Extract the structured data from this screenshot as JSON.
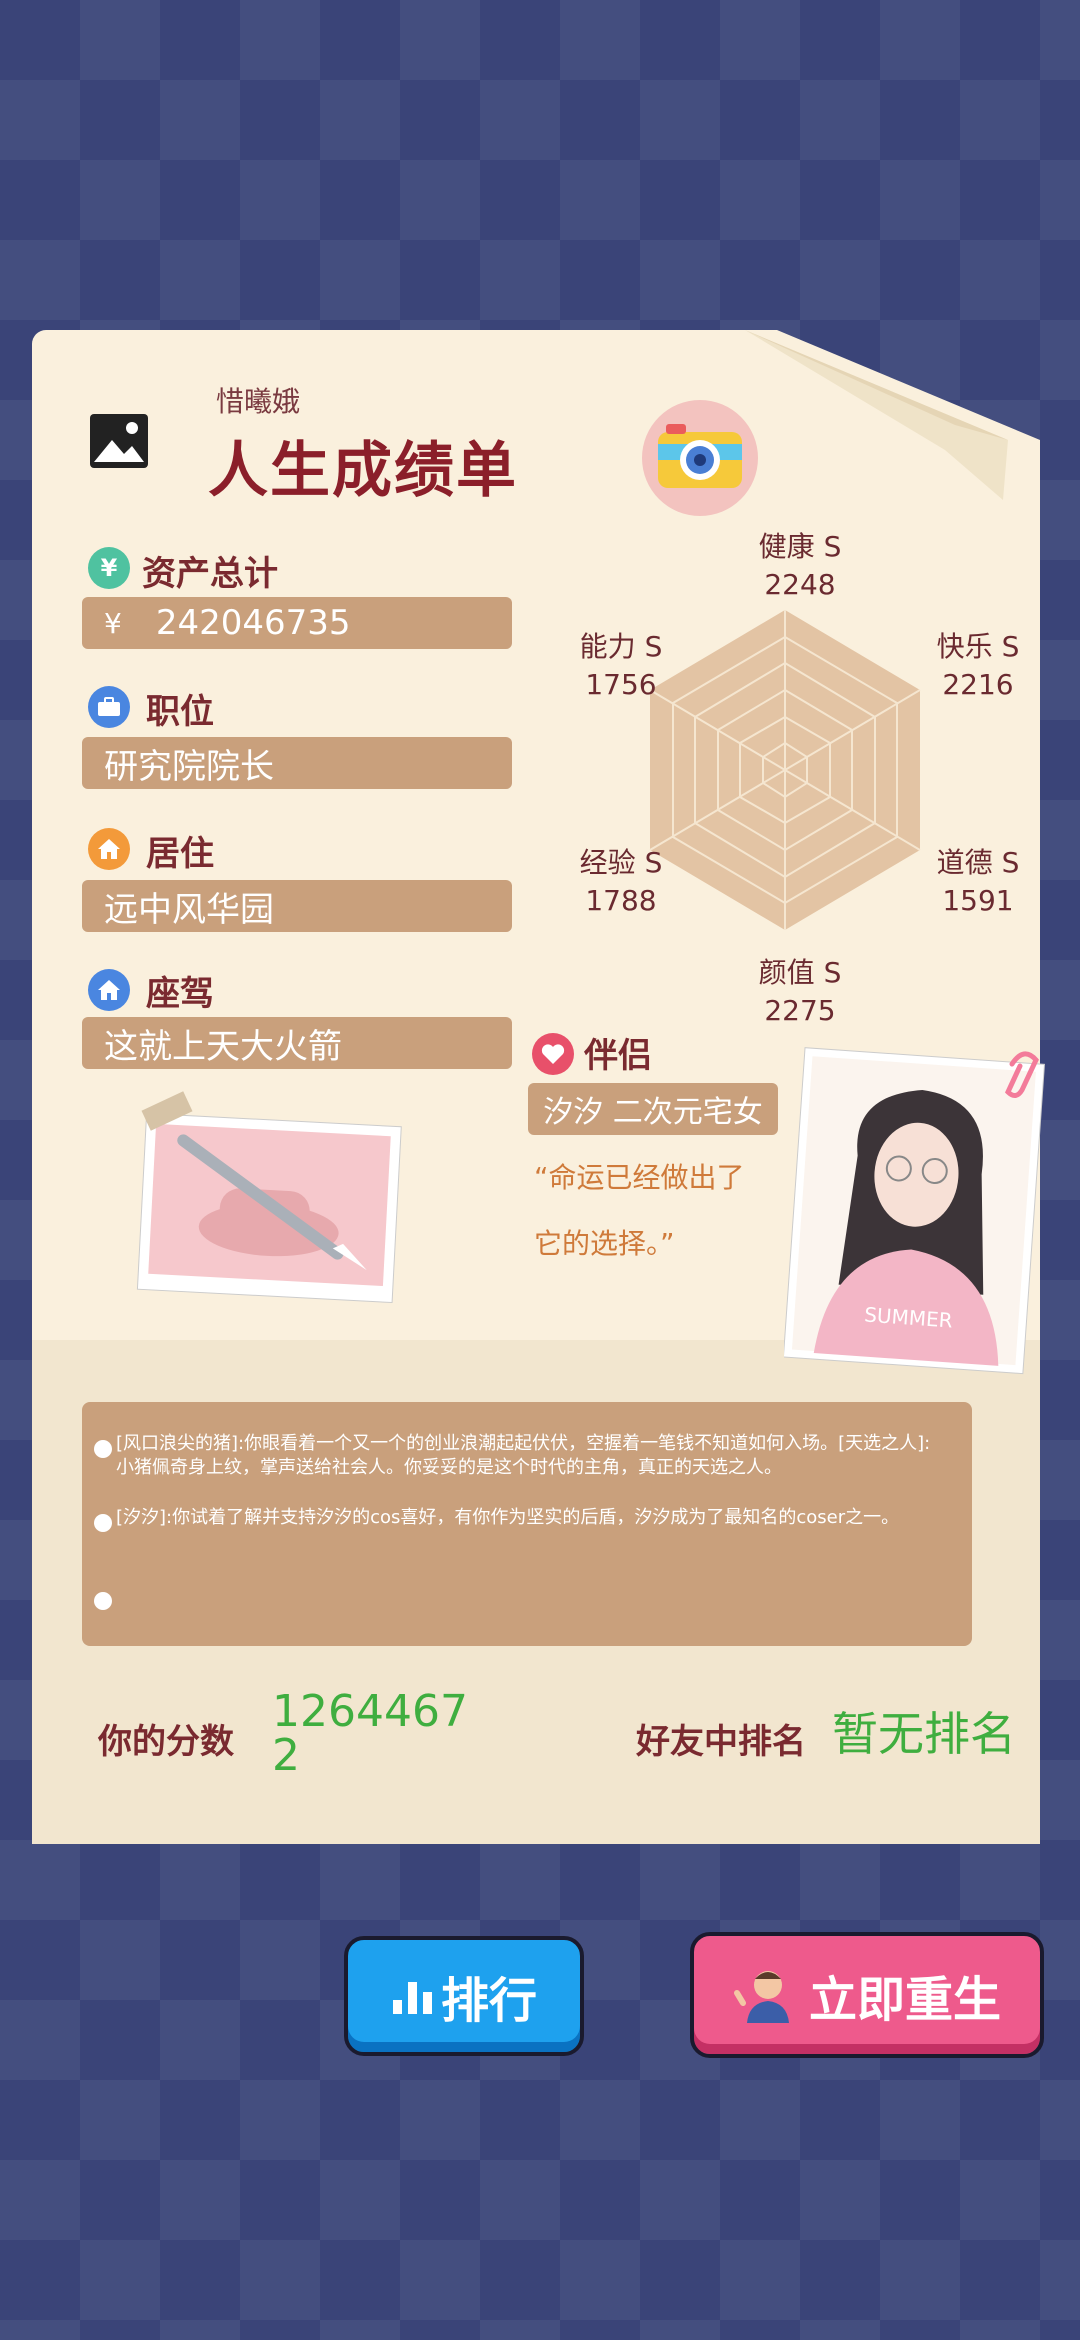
{
  "header": {
    "player_name": "惜曦娥",
    "title": "人生成绩单"
  },
  "assets": {
    "label": "资产总计",
    "icon": "yen-icon",
    "currency": "¥",
    "value": "242046735"
  },
  "job": {
    "label": "职位",
    "icon": "briefcase-icon",
    "value": "研究院院长"
  },
  "residence": {
    "label": "居住",
    "icon": "home-icon",
    "value": "远中风华园"
  },
  "vehicle": {
    "label": "座驾",
    "icon": "home-icon",
    "value": "这就上天大火箭"
  },
  "stats": [
    {
      "name": "健康",
      "grade": "S",
      "value": "2248"
    },
    {
      "name": "快乐",
      "grade": "S",
      "value": "2216"
    },
    {
      "name": "道德",
      "grade": "S",
      "value": "1591"
    },
    {
      "name": "颜值",
      "grade": "S",
      "value": "2275"
    },
    {
      "name": "经验",
      "grade": "S",
      "value": "1788"
    },
    {
      "name": "能力",
      "grade": "S",
      "value": "1756"
    }
  ],
  "partner": {
    "label": "伴侣",
    "icon": "heart-icon",
    "name": "汐汐 二次元宅女",
    "quote_line1": "“命运已经做出了",
    "quote_line2": "它的选择。”",
    "shirt_text": "SUMMER"
  },
  "log": [
    "[风口浪尖的猪]:你眼看着一个又一个的创业浪潮起起伏伏，空握着一笔钱不知道如何入场。[天选之人]:小猪佩奇身上纹，掌声送给社会人。你妥妥的是这个时代的主角，真正的天选之人。",
    "[汐汐]:你试着了解并支持汐汐的cos喜好，有你作为坚实的后盾，汐汐成为了最知名的coser之一。",
    ""
  ],
  "score": {
    "label": "你的分数",
    "value_line1": "1264467",
    "value_line2": "2"
  },
  "rank": {
    "label": "好友中排名",
    "value": "暂无排名"
  },
  "buttons": {
    "rank_label": "排行",
    "reborn_label": "立即重生"
  },
  "colors": {
    "accent_red": "#8b1f2a",
    "bar_tan": "#c9a07c",
    "score_green": "#3fae3f",
    "btn_blue": "#1ea1ee",
    "btn_pink": "#ee5a8c"
  }
}
